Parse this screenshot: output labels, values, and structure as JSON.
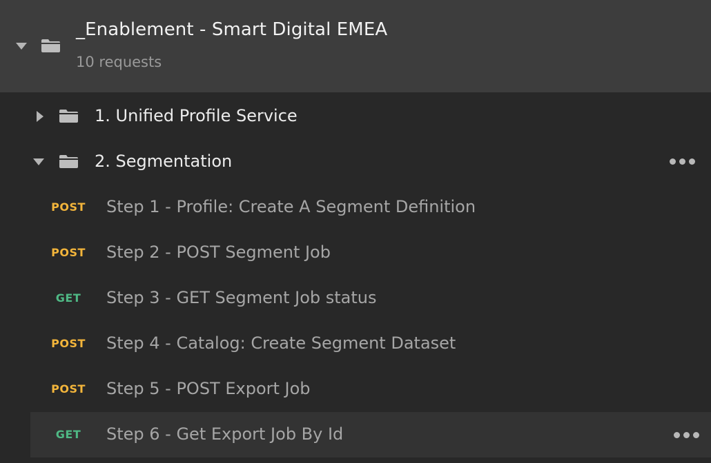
{
  "collection": {
    "name": "_Enablement - Smart Digital EMEA",
    "meta": "10 requests",
    "expanded": true
  },
  "folders": [
    {
      "label": "1. Unified Profile Service",
      "expanded": false
    },
    {
      "label": "2. Segmentation",
      "expanded": true
    }
  ],
  "requests": [
    {
      "method": "POST",
      "label": "Step 1 - Profile: Create A Segment Definition"
    },
    {
      "method": "POST",
      "label": "Step 2 - POST Segment Job"
    },
    {
      "method": "GET",
      "label": "Step 3 - GET Segment Job status"
    },
    {
      "method": "POST",
      "label": "Step 4 - Catalog: Create Segment Dataset"
    },
    {
      "method": "POST",
      "label": "Step 5 - POST Export Job"
    },
    {
      "method": "GET",
      "label": "Step 6 - Get Export Job By Id"
    }
  ],
  "colors": {
    "post": "#f3b53b",
    "get": "#4fb985",
    "background": "#282828",
    "header_background": "#3d3d3d"
  },
  "icons": {
    "collection": "folder-icon",
    "folder": "folder-icon",
    "expand": "caret-down-icon",
    "collapse": "caret-right-icon",
    "more": "more-options-icon"
  }
}
